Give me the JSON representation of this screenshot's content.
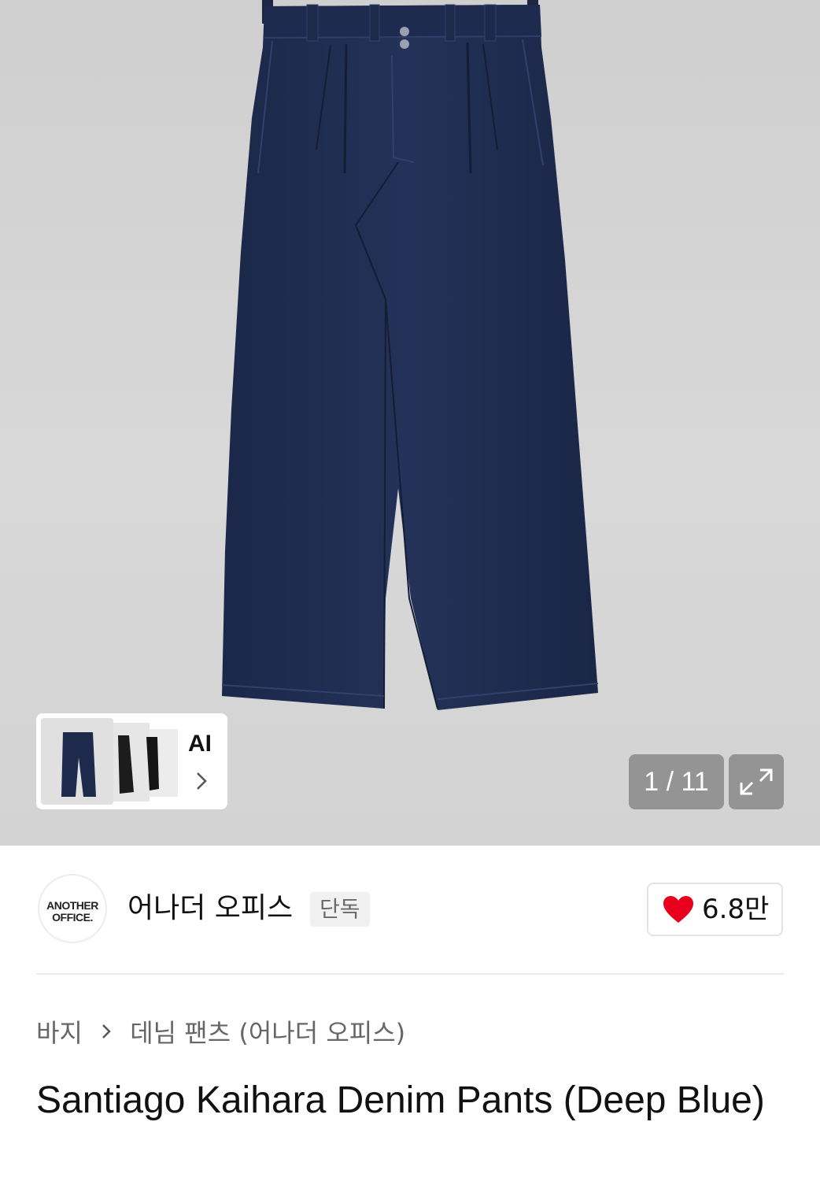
{
  "gallery": {
    "ai_label": "AI",
    "counter": "1 / 11"
  },
  "brand": {
    "logo_line1": "ANOTHER",
    "logo_line2": "OFFICE.",
    "name": "어나더 오피스",
    "badge": "단독"
  },
  "like": {
    "count": "6.8만",
    "color": "#e8001c"
  },
  "breadcrumb": {
    "category": "바지",
    "subcategory": "데님 팬츠 (어나더 오피스)"
  },
  "product": {
    "title": "Santiago Kaihara Denim Pants (Deep Blue)"
  },
  "icons": {
    "gallery_expand": "expand-icon",
    "ai_chevron": "chevron-right-icon",
    "breadcrumb_separator": "chevron-right-icon",
    "like": "heart-icon"
  }
}
